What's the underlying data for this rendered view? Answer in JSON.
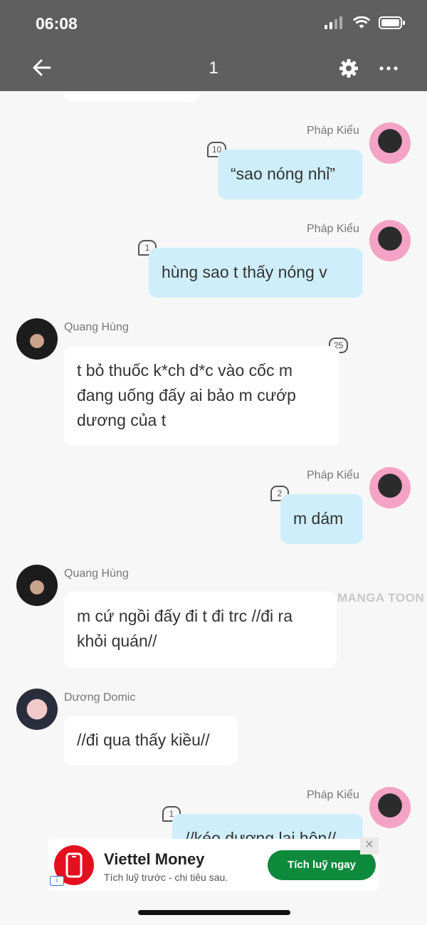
{
  "status": {
    "time": "06:08"
  },
  "header": {
    "title": "1"
  },
  "messages": [
    {
      "sender": "Pháp Kiểu",
      "text": "“sao nóng nhỉ”",
      "count": "10",
      "side": "out"
    },
    {
      "sender": "Pháp Kiểu",
      "text": "hùng sao t thấy nóng v",
      "count": "1",
      "side": "out"
    },
    {
      "sender": "Quang Hùng",
      "text": "t bỏ thuốc k*ch d*c vào cốc m đang uống đấy ai bảo m cướp dương của t",
      "count": "25",
      "side": "in"
    },
    {
      "sender": "Pháp Kiểu",
      "text": "m dám",
      "count": "2",
      "side": "out"
    },
    {
      "sender": "Quang Hùng",
      "text": "m cứ ngồi đấy đi t đi trc //đi ra khỏi quán//",
      "side": "in"
    },
    {
      "sender": "Dương Domic",
      "text": "//đi qua thấy kiều//",
      "side": "in"
    },
    {
      "sender": "Pháp Kiểu",
      "text": "//kéo dương lại hôn//",
      "count": "1",
      "side": "out"
    }
  ],
  "watermark": "MANGA TOON",
  "ad": {
    "title": "Viettel Money",
    "subtitle": "Tích luỹ trước - chi tiêu sau.",
    "cta": "Tích luỹ ngay",
    "close": "✕",
    "info": "i"
  },
  "colors": {
    "header_bg": "#5f5f5f",
    "outgoing_bubble": "#cfeefb",
    "incoming_bubble": "#ffffff",
    "ad_cta": "#0d8a3c",
    "ad_logo": "#e5101f"
  },
  "icons": [
    "back-arrow-icon",
    "gear-icon",
    "more-icon",
    "signal-icon",
    "wifi-icon",
    "battery-icon",
    "phone-icon"
  ]
}
